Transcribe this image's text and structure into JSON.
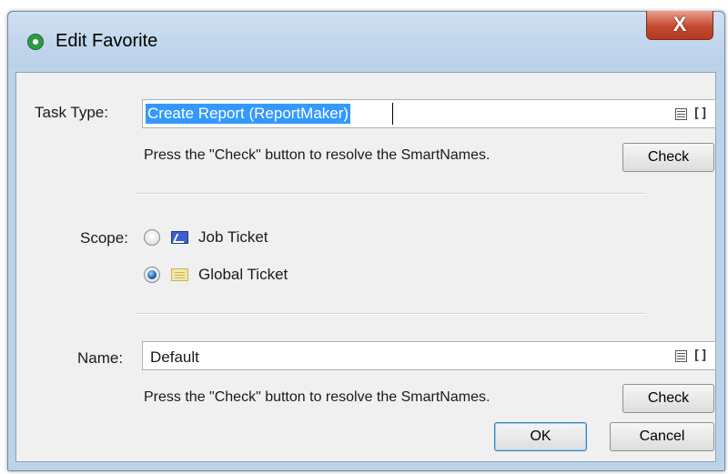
{
  "window": {
    "title": "Edit Favorite",
    "close_label": "X"
  },
  "task_type": {
    "label": "Task Type:",
    "value": "Create Report (ReportMaker)",
    "hint": "Press the \"Check\" button to resolve the SmartNames.",
    "check_label": "Check"
  },
  "scope": {
    "label": "Scope:",
    "options": [
      {
        "label": "Job Ticket",
        "selected": false,
        "icon": "job-ticket-icon"
      },
      {
        "label": "Global Ticket",
        "selected": true,
        "icon": "global-ticket-icon"
      }
    ]
  },
  "name": {
    "label": "Name:",
    "value": "Default",
    "hint": "Press the \"Check\" button to resolve the SmartNames.",
    "check_label": "Check"
  },
  "footer": {
    "ok_label": "OK",
    "cancel_label": "Cancel"
  },
  "field_icons": {
    "list": "document-list-icon",
    "bracket": "[]"
  }
}
